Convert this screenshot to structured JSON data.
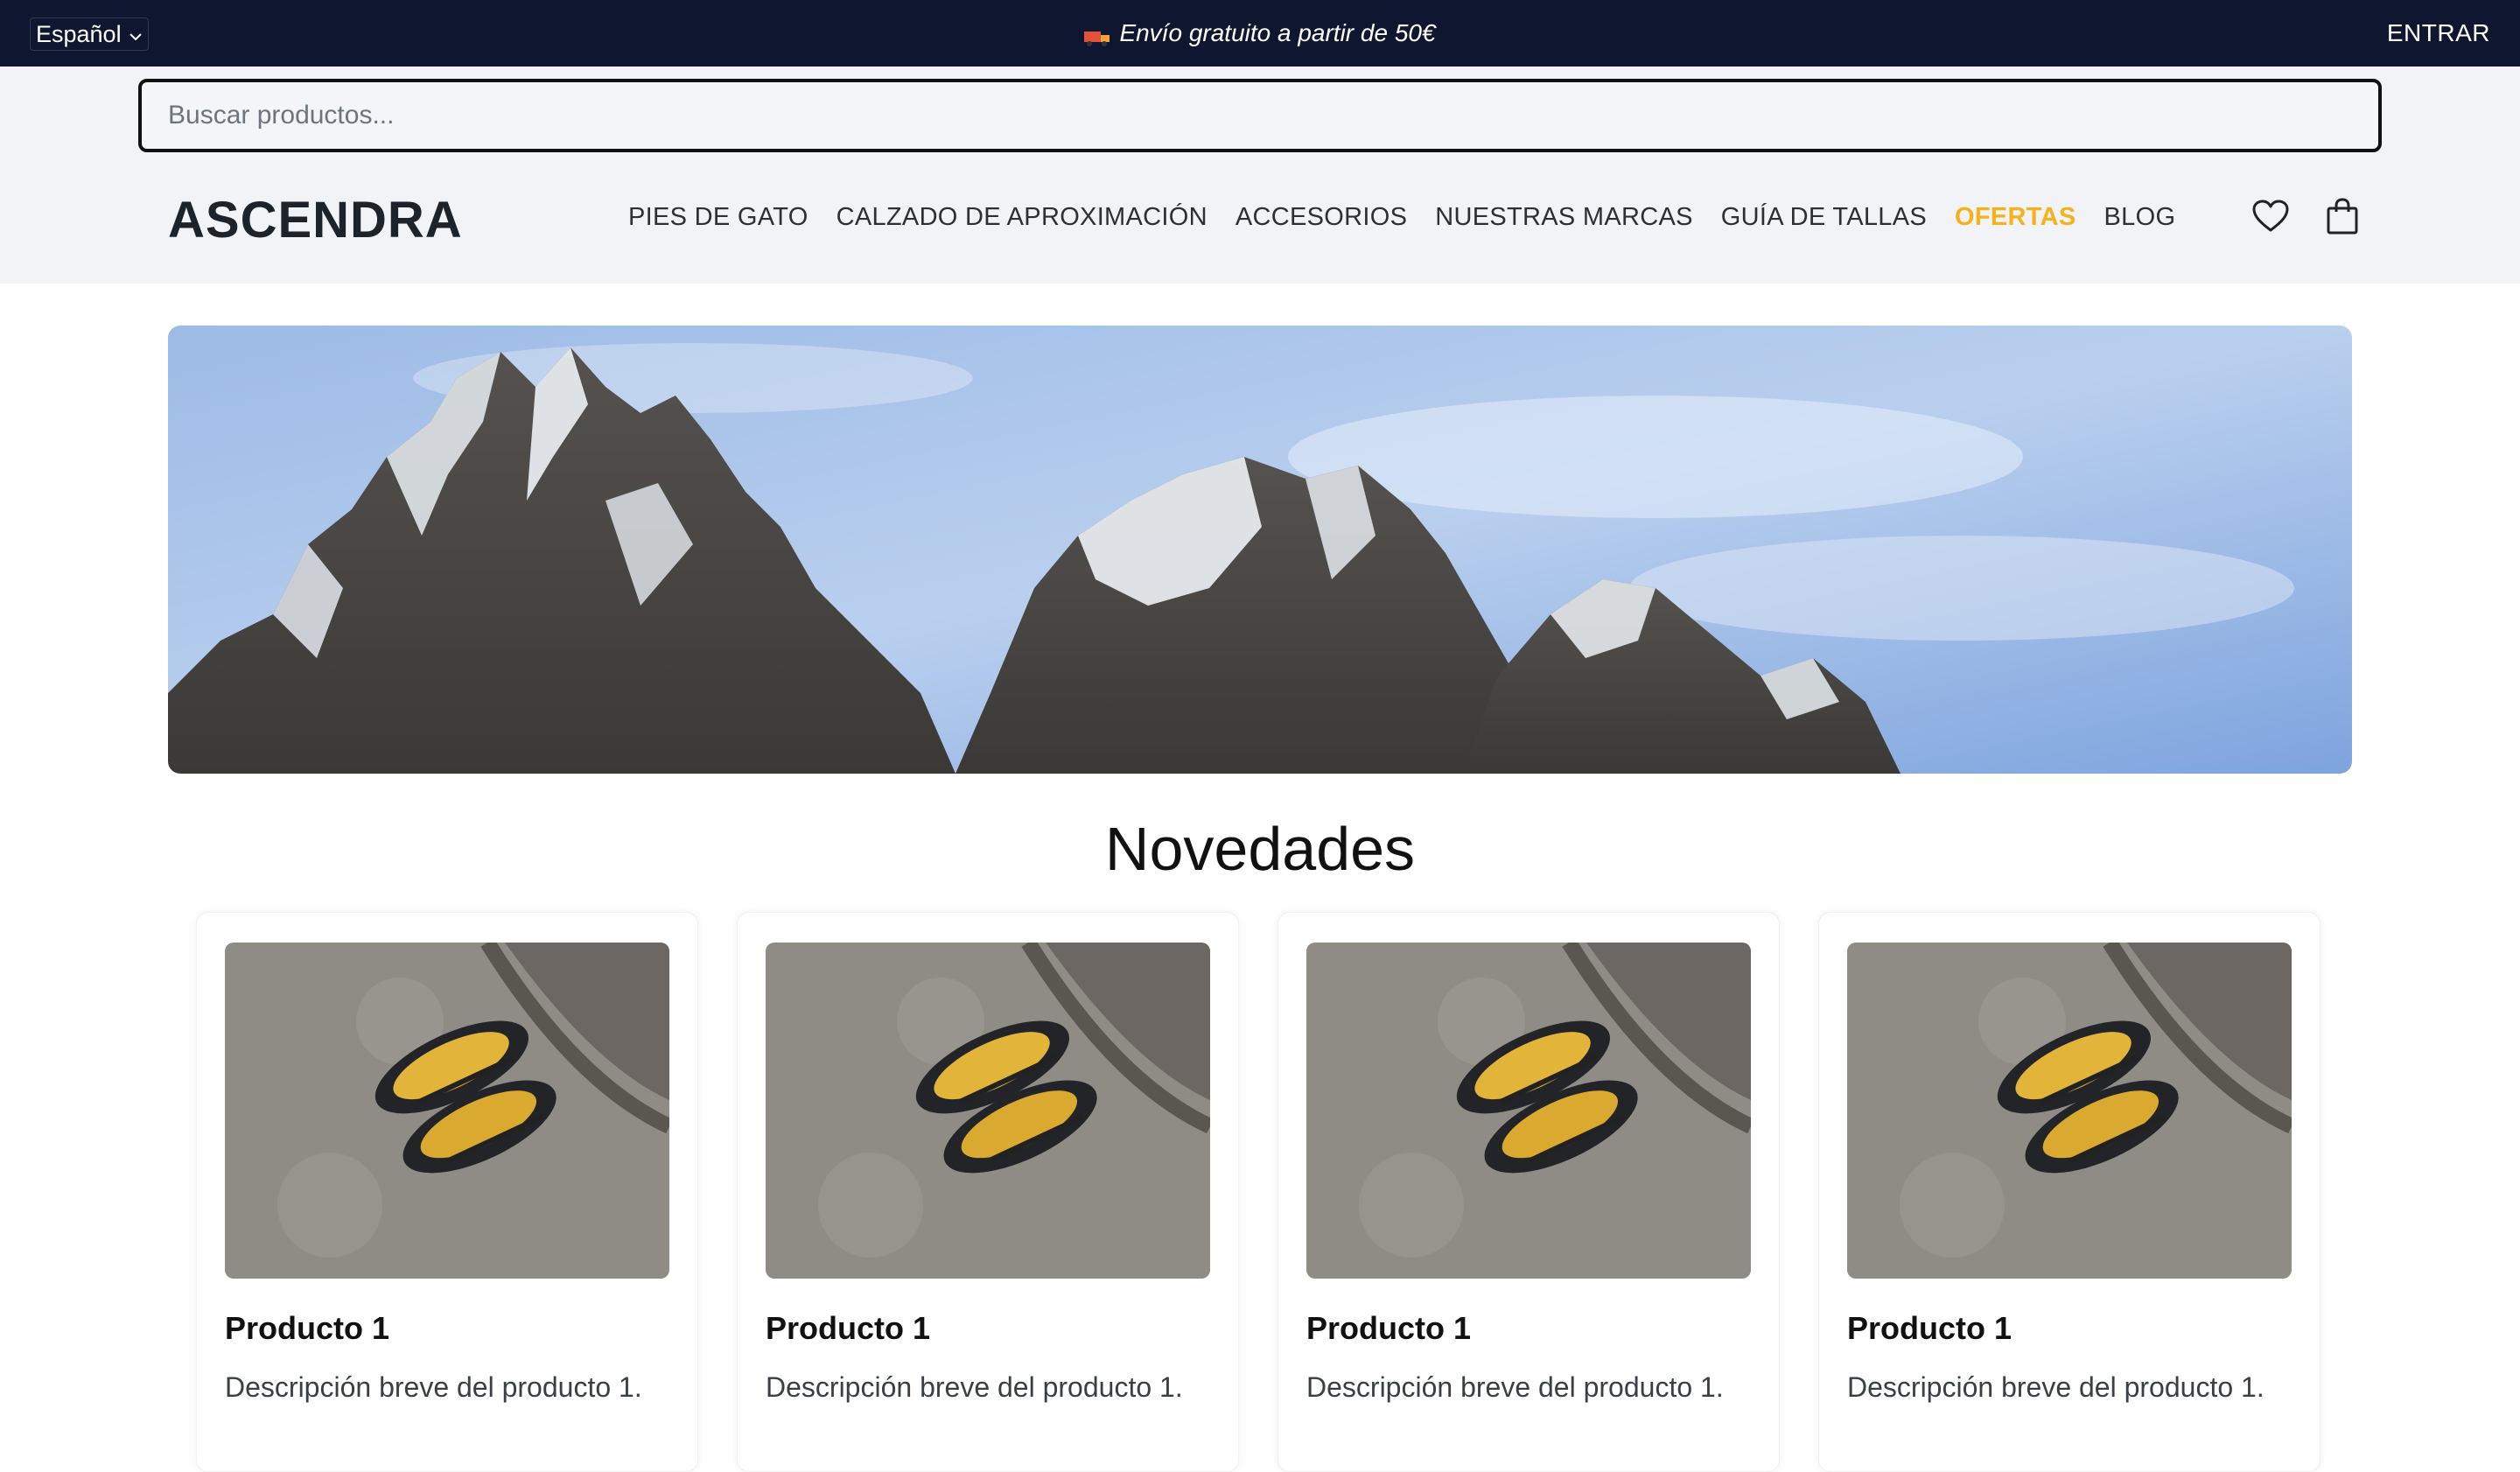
{
  "topbar": {
    "language": "Español",
    "promo": "Envío gratuito a partir de 50€",
    "login": "ENTRAR"
  },
  "search": {
    "placeholder": "Buscar productos..."
  },
  "brand": "ASCENDRA",
  "nav": [
    {
      "label": "PIES DE GATO"
    },
    {
      "label": "CALZADO DE APROXIMACIÓN"
    },
    {
      "label": "ACCESORIOS"
    },
    {
      "label": "NUESTRAS MARCAS"
    },
    {
      "label": "GUÍA DE TALLAS"
    },
    {
      "label": "OFERTAS"
    },
    {
      "label": "BLOG"
    }
  ],
  "header_icons": [
    "heart-icon",
    "shopping-bag-icon"
  ],
  "section_title": "Novedades",
  "products": [
    {
      "name": "Producto 1",
      "description": "Descripción breve del producto 1."
    },
    {
      "name": "Producto 1",
      "description": "Descripción breve del producto 1."
    },
    {
      "name": "Producto 1",
      "description": "Descripción breve del producto 1."
    },
    {
      "name": "Producto 1",
      "description": "Descripción breve del producto 1."
    }
  ],
  "colors": {
    "topbar": "#0f1730",
    "accent_offer": "#f5b21a",
    "header_bg": "#f1f3f7"
  }
}
